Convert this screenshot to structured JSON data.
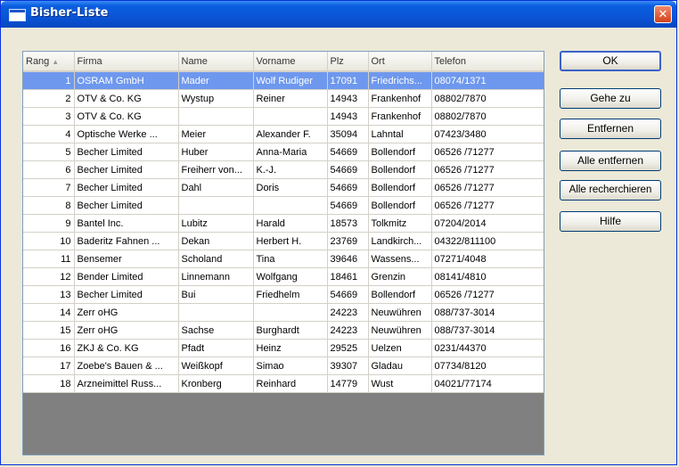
{
  "window": {
    "title": "Bisher-Liste",
    "close_glyph": "✕"
  },
  "table": {
    "columns": [
      "Rang",
      "Firma",
      "Name",
      "Vorname",
      "Plz",
      "Ort",
      "Telefon"
    ],
    "sort_arrow": "▲",
    "selected_row": 0,
    "rows": [
      [
        "1",
        "OSRAM GmbH",
        "Mader",
        "Wolf Rudiger",
        "17091",
        "Friedrichs...",
        "08074/1371"
      ],
      [
        "2",
        "OTV & Co. KG",
        "Wystup",
        "Reiner",
        "14943",
        "Frankenhof",
        "08802/7870"
      ],
      [
        "3",
        "OTV & Co. KG",
        "",
        "",
        "14943",
        "Frankenhof",
        "08802/7870"
      ],
      [
        "4",
        "Optische Werke ...",
        "Meier",
        "Alexander F.",
        "35094",
        "Lahntal",
        "07423/3480"
      ],
      [
        "5",
        "Becher Limited",
        "Huber",
        "Anna-Maria",
        "54669",
        "Bollendorf",
        "06526 /71277"
      ],
      [
        "6",
        "Becher Limited",
        "Freiherr von...",
        "K.-J.",
        "54669",
        "Bollendorf",
        "06526 /71277"
      ],
      [
        "7",
        "Becher Limited",
        "Dahl",
        "Doris",
        "54669",
        "Bollendorf",
        "06526 /71277"
      ],
      [
        "8",
        "Becher Limited",
        "",
        "",
        "54669",
        "Bollendorf",
        "06526 /71277"
      ],
      [
        "9",
        "Bantel Inc.",
        "Lubitz",
        "Harald",
        "18573",
        "Tolkmitz",
        "07204/2014"
      ],
      [
        "10",
        "Baderitz Fahnen ...",
        "Dekan",
        "Herbert H.",
        "23769",
        "Landkirch...",
        "04322/811100"
      ],
      [
        "11",
        "Bensemer",
        "Scholand",
        "Tina",
        "39646",
        "Wassens...",
        "07271/4048"
      ],
      [
        "12",
        "Bender Limited",
        "Linnemann",
        "Wolfgang",
        "18461",
        "Grenzin",
        "08141/4810"
      ],
      [
        "13",
        "Becher Limited",
        "Bui",
        "Friedhelm",
        "54669",
        "Bollendorf",
        "06526 /71277"
      ],
      [
        "14",
        "Zerr oHG",
        "",
        "",
        "24223",
        "Neuwühren",
        "088/737-3014"
      ],
      [
        "15",
        "Zerr oHG",
        "Sachse",
        "Burghardt",
        "24223",
        "Neuwühren",
        "088/737-3014"
      ],
      [
        "16",
        "ZKJ & Co. KG",
        "Pfadt",
        "Heinz",
        "29525",
        "Uelzen",
        "0231/44370"
      ],
      [
        "17",
        "Zoebe's Bauen & ...",
        "Weißkopf",
        "Simao",
        "39307",
        "Gladau",
        "07734/8120"
      ],
      [
        "18",
        "Arzneimittel Russ...",
        "Kronberg",
        "Reinhard",
        "14779",
        "Wust",
        "04021/77174"
      ]
    ]
  },
  "buttons": {
    "ok": "OK",
    "goto": "Gehe zu",
    "remove": "Entfernen",
    "remove_all": "Alle entfernen",
    "research_all": "Alle recherchieren",
    "help": "Hilfe"
  }
}
